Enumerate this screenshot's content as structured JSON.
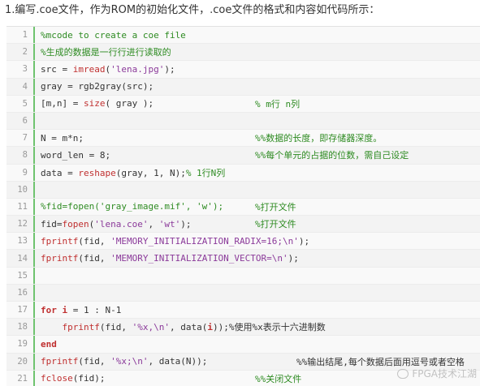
{
  "intro": "1.编写.coe文件，作为ROM的初始化文件，.coe文件的格式和内容如代码所示：",
  "lines": [
    {
      "num": "1",
      "parts": [
        {
          "t": "%mcode to create a coe file",
          "c": "comment"
        }
      ]
    },
    {
      "num": "2",
      "parts": [
        {
          "t": "%生成的数据是一行行进行读取的",
          "c": "comment"
        }
      ]
    },
    {
      "num": "3",
      "parts": [
        {
          "t": "src = ",
          "c": ""
        },
        {
          "t": "imread",
          "c": "fn"
        },
        {
          "t": "(",
          "c": ""
        },
        {
          "t": "'lena.jpg'",
          "c": "str"
        },
        {
          "t": ");",
          "c": ""
        }
      ]
    },
    {
      "num": "4",
      "parts": [
        {
          "t": "gray = rgb2gray(src);",
          "c": ""
        }
      ]
    },
    {
      "num": "5",
      "parts": [
        {
          "t": "[m,n] = ",
          "c": ""
        },
        {
          "t": "size",
          "c": "fn"
        },
        {
          "t": "( gray );",
          "c": ""
        }
      ],
      "comment": "% m行 n列"
    },
    {
      "num": "6",
      "parts": []
    },
    {
      "num": "7",
      "parts": [
        {
          "t": "N = m*n;",
          "c": ""
        }
      ],
      "comment": "%%数据的长度，即存储器深度。"
    },
    {
      "num": "8",
      "parts": [
        {
          "t": "word_len = 8;",
          "c": ""
        }
      ],
      "comment": "%%每个单元的占据的位数，需自己设定"
    },
    {
      "num": "9",
      "parts": [
        {
          "t": "data = ",
          "c": ""
        },
        {
          "t": "reshape",
          "c": "fn"
        },
        {
          "t": "(gray, 1, N);",
          "c": ""
        },
        {
          "t": "% 1行N列",
          "c": "comment"
        }
      ]
    },
    {
      "num": "10",
      "parts": []
    },
    {
      "num": "11",
      "parts": [
        {
          "t": "%fid=fopen('gray_image.mif', 'w');",
          "c": "comment"
        }
      ],
      "comment": "%打开文件"
    },
    {
      "num": "12",
      "parts": [
        {
          "t": "fid=",
          "c": ""
        },
        {
          "t": "fopen",
          "c": "fn"
        },
        {
          "t": "(",
          "c": ""
        },
        {
          "t": "'lena.coe'",
          "c": "str"
        },
        {
          "t": ", ",
          "c": ""
        },
        {
          "t": "'wt'",
          "c": "str"
        },
        {
          "t": ");",
          "c": ""
        }
      ],
      "comment": "%打开文件"
    },
    {
      "num": "13",
      "parts": [
        {
          "t": "fprintf",
          "c": "fn"
        },
        {
          "t": "(fid, ",
          "c": ""
        },
        {
          "t": "'MEMORY_INITIALIZATION_RADIX=16;\\n'",
          "c": "str"
        },
        {
          "t": ");",
          "c": ""
        }
      ]
    },
    {
      "num": "14",
      "parts": [
        {
          "t": "fprintf",
          "c": "fn"
        },
        {
          "t": "(fid, ",
          "c": ""
        },
        {
          "t": "'MEMORY_INITIALIZATION_VECTOR=\\n'",
          "c": "str"
        },
        {
          "t": ");",
          "c": ""
        }
      ]
    },
    {
      "num": "15",
      "parts": []
    },
    {
      "num": "16",
      "parts": []
    },
    {
      "num": "17",
      "parts": [
        {
          "t": "for",
          "c": "kw"
        },
        {
          "t": " ",
          "c": ""
        },
        {
          "t": "i",
          "c": "kw"
        },
        {
          "t": " = 1 : N-1",
          "c": ""
        }
      ]
    },
    {
      "num": "18",
      "parts": [
        {
          "t": "    ",
          "c": ""
        },
        {
          "t": "fprintf",
          "c": "fn"
        },
        {
          "t": "(fid, ",
          "c": ""
        },
        {
          "t": "'%x,\\n'",
          "c": "str"
        },
        {
          "t": ", data(",
          "c": ""
        },
        {
          "t": "i",
          "c": "kw"
        },
        {
          "t": "));",
          "c": ""
        },
        {
          "t": "%使用%x表示十六进制数",
          "c": ""
        }
      ]
    },
    {
      "num": "19",
      "parts": [
        {
          "t": "end",
          "c": "kw"
        }
      ]
    },
    {
      "num": "20",
      "parts": [
        {
          "t": "fprintf",
          "c": "fn"
        },
        {
          "t": "(fid, ",
          "c": ""
        },
        {
          "t": "'%x;\\n'",
          "c": "str"
        },
        {
          "t": ", data(N));",
          "c": ""
        }
      ],
      "comment2": "%%输出结尾,每个数据后面用逗号或者空格"
    },
    {
      "num": "21",
      "parts": [
        {
          "t": "fclose",
          "c": "fn"
        },
        {
          "t": "(fid);",
          "c": ""
        }
      ],
      "comment": "%%关闭文件"
    }
  ],
  "watermark": "FPGA技术江湖"
}
